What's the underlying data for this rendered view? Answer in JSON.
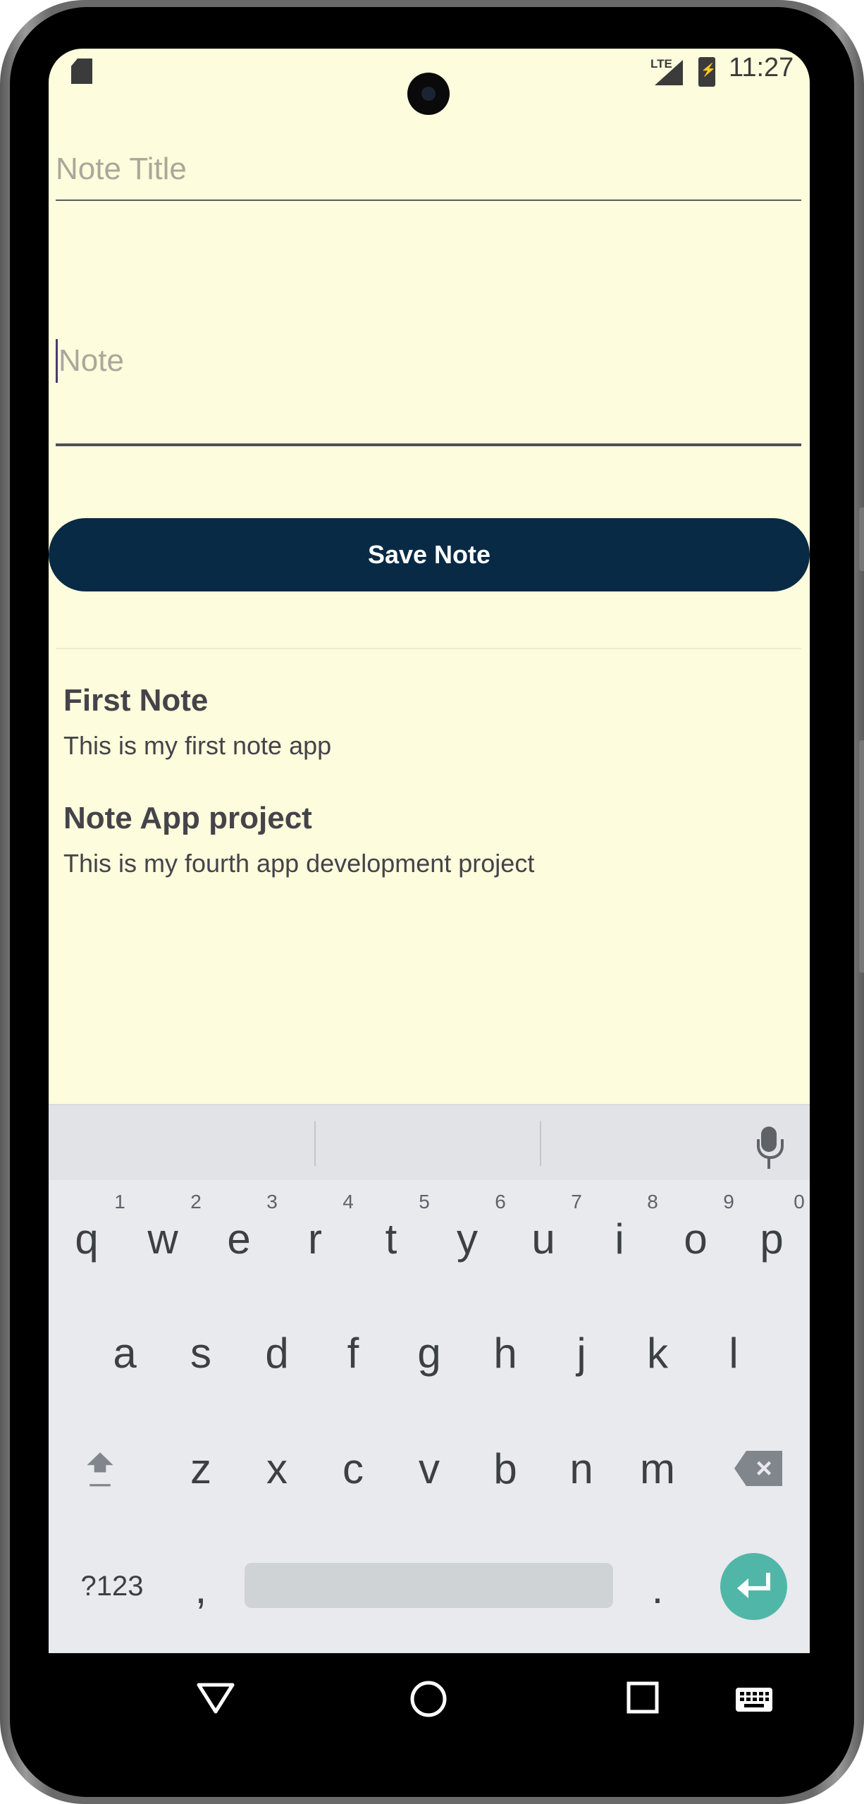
{
  "status_bar": {
    "network_label": "LTE",
    "time": "11:27"
  },
  "form": {
    "title_placeholder": "Note Title",
    "note_placeholder": "Note",
    "save_label": "Save Note"
  },
  "notes": [
    {
      "title": "First Note",
      "body": "This is my first note app"
    },
    {
      "title": "Note App project",
      "body": "This is my fourth app development project"
    }
  ],
  "keyboard": {
    "row1": [
      "q",
      "w",
      "e",
      "r",
      "t",
      "y",
      "u",
      "i",
      "o",
      "p"
    ],
    "row1_hints": [
      "1",
      "2",
      "3",
      "4",
      "5",
      "6",
      "7",
      "8",
      "9",
      "0"
    ],
    "row2": [
      "a",
      "s",
      "d",
      "f",
      "g",
      "h",
      "j",
      "k",
      "l"
    ],
    "row3": [
      "z",
      "x",
      "c",
      "v",
      "b",
      "n",
      "m"
    ],
    "symbols_label": "?123",
    "comma": ",",
    "period": "."
  },
  "colors": {
    "background": "#fdfcdc",
    "button": "#082a45",
    "enter_key": "#50b7a8"
  }
}
